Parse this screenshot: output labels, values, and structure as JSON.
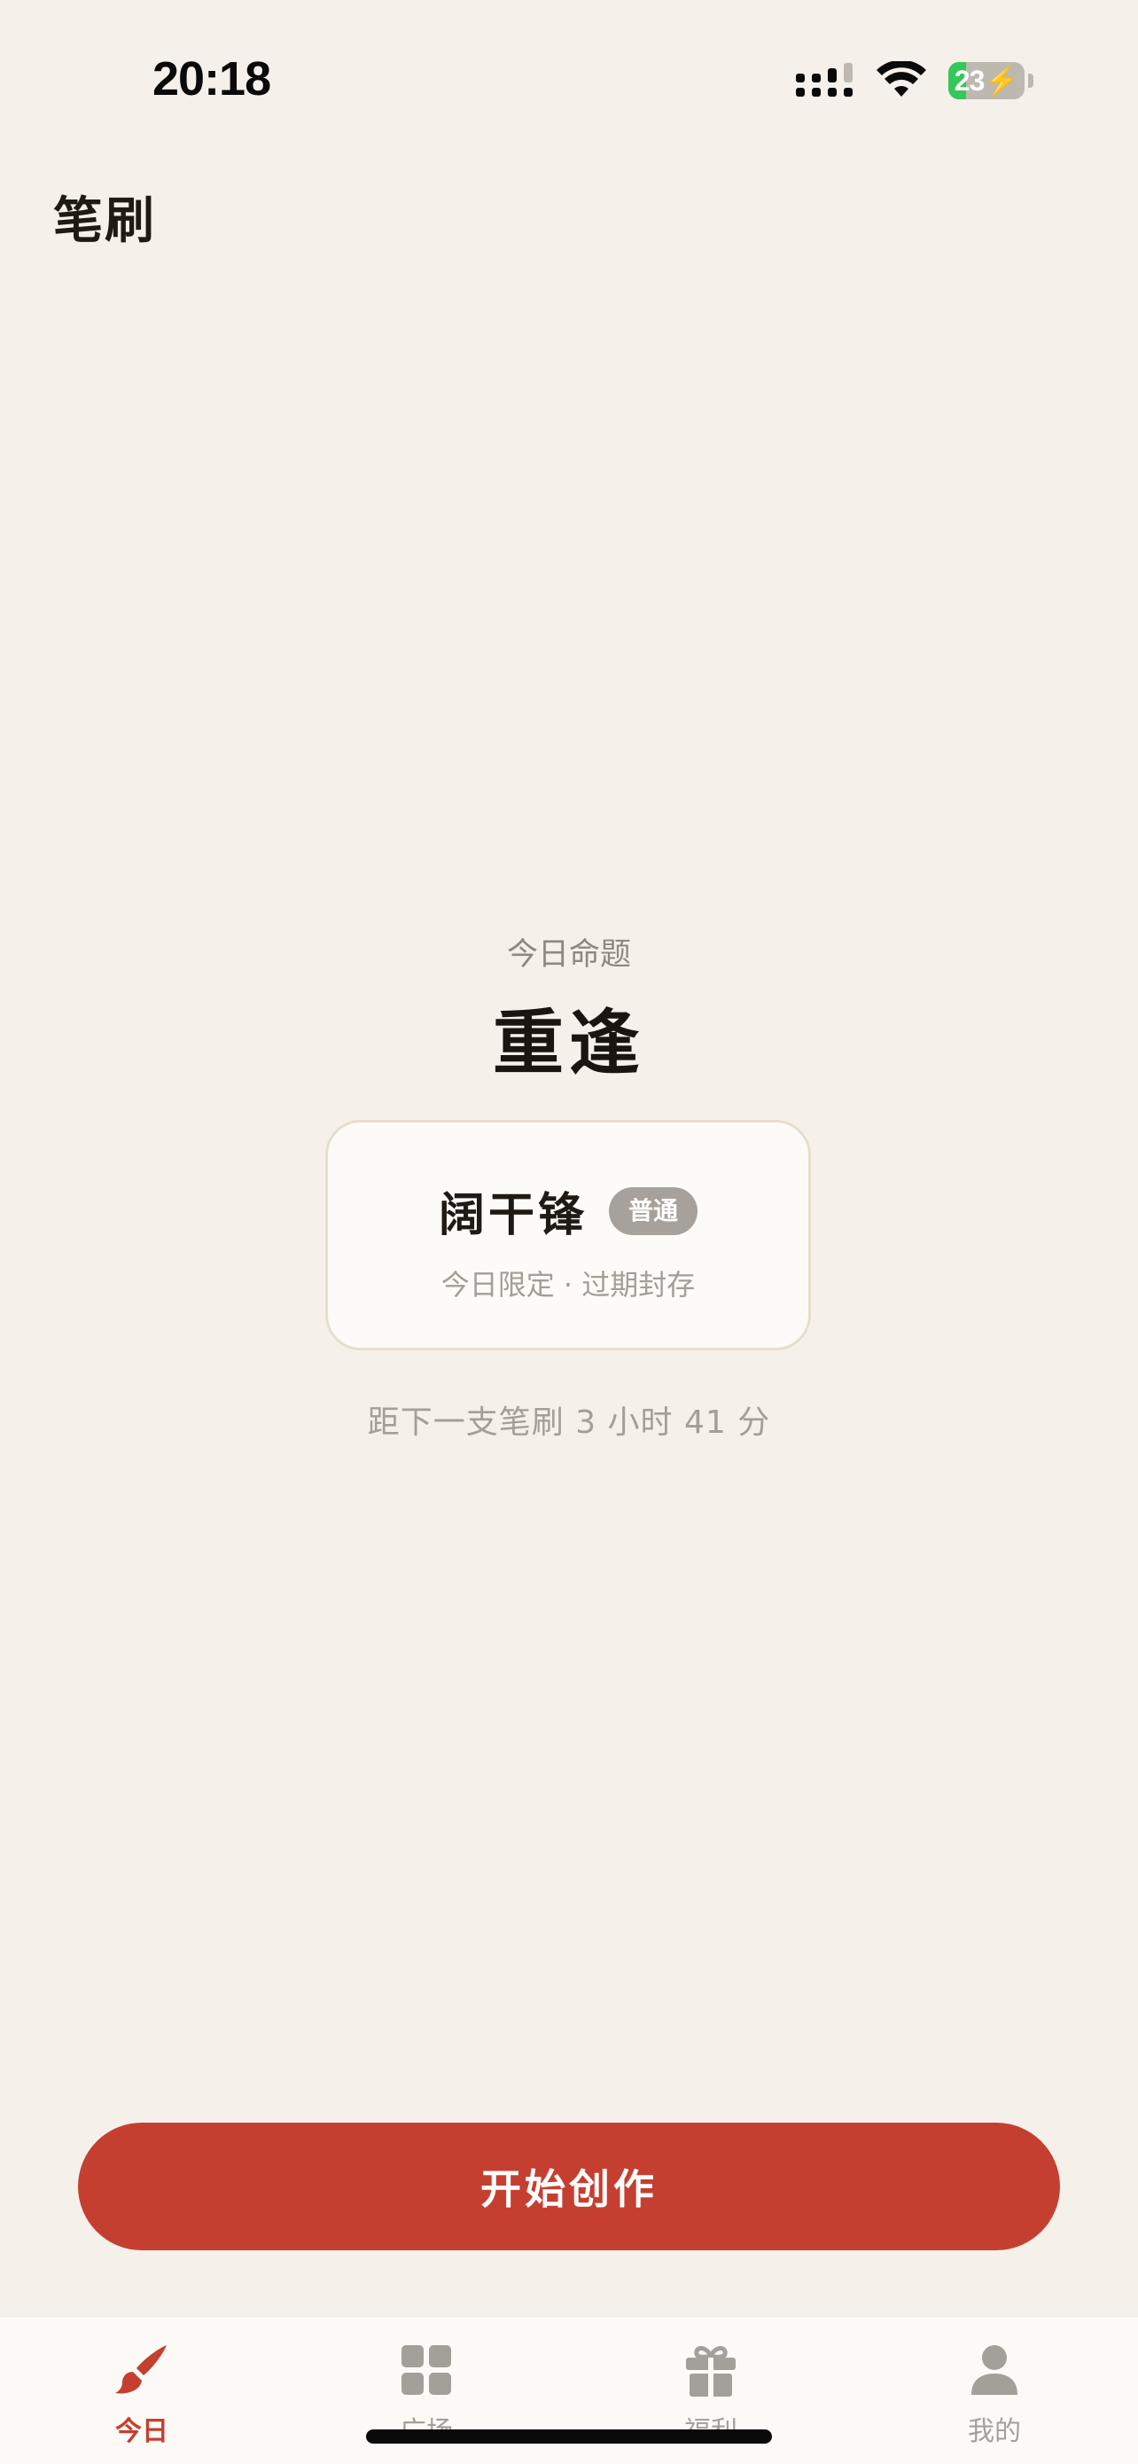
{
  "status_bar": {
    "time": "20:18",
    "battery_text": "23",
    "battery_level": 0.23,
    "battery_color": "#34C759",
    "icons": [
      "cellular-signal-icon",
      "wifi-icon",
      "battery-charging-icon"
    ]
  },
  "header": {
    "title": "笔刷"
  },
  "today": {
    "prompt_label": "今日命题",
    "prompt_word": "重逢",
    "brush_card": {
      "name": "阔干锋",
      "rarity": "普通",
      "note": "今日限定 · 过期封存"
    },
    "next_brush": "距下一支笔刷 3 小时 41 分"
  },
  "cta": {
    "label": "开始创作"
  },
  "tab_bar": {
    "tabs": [
      {
        "label": "今日",
        "icon": "brush-icon",
        "active": true
      },
      {
        "label": "广场",
        "icon": "grid-icon",
        "active": false
      },
      {
        "label": "福利",
        "icon": "gift-icon",
        "active": false
      },
      {
        "label": "我的",
        "icon": "person-icon",
        "active": false
      }
    ]
  },
  "colors": {
    "background": "#F5F1EA",
    "accent": "#C53F31",
    "inactive": "#A3A09A",
    "badge": "#A6A29B"
  }
}
